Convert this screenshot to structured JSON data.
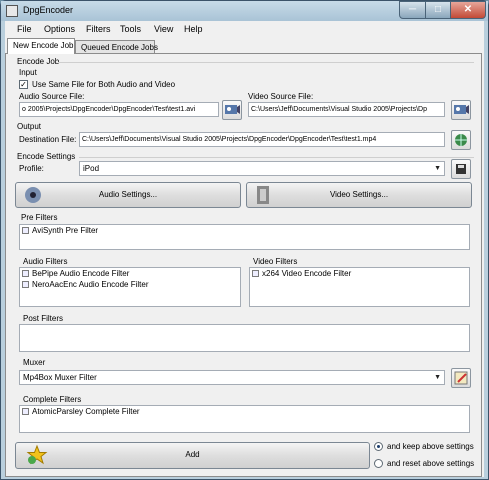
{
  "window": {
    "title": "DpgEncoder",
    "minimize": "─",
    "maximize": "□",
    "close": "✕"
  },
  "menu": [
    "File",
    "Options",
    "Filters",
    "Tools",
    "View",
    "Help"
  ],
  "tabs": [
    "New Encode Job",
    "Queued Encode Jobs"
  ],
  "encode_job": {
    "group_label": "Encode Job",
    "input_label": "Input",
    "same_file_checkbox": {
      "label": "Use Same File for Both Audio and Video",
      "checked": true
    },
    "audio_source_label": "Audio Source File:",
    "audio_source_value": "o 2005\\Projects\\DpgEncoder\\DpgEncoder\\Test\\test1.avi",
    "video_source_label": "Video Source File:",
    "video_source_value": "C:\\Users\\Jeff\\Documents\\Visual Studio 2005\\Projects\\Dp",
    "output_label": "Output",
    "destination_label": "Destination File:",
    "destination_value": "C:\\Users\\Jeff\\Documents\\Visual Studio 2005\\Projects\\DpgEncoder\\DpgEncoder\\Test\\test1.mp4"
  },
  "encode_settings": {
    "group_label": "Encode Settings",
    "profile_label": "Profile:",
    "profile_value": "iPod",
    "audio_settings_button": "Audio Settings...",
    "video_settings_button": "Video Settings..."
  },
  "pre_filters": {
    "label": "Pre Filters",
    "items": [
      "AviSynth Pre Filter"
    ]
  },
  "audio_filters": {
    "label": "Audio Filters",
    "items": [
      "BePipe Audio Encode Filter",
      "NeroAacEnc Audio Encode Filter"
    ]
  },
  "video_filters": {
    "label": "Video Filters",
    "items": [
      "x264 Video Encode Filter"
    ]
  },
  "post_filters": {
    "label": "Post Filters",
    "items": []
  },
  "muxer": {
    "label": "Muxer",
    "value": "Mp4Box Muxer Filter"
  },
  "complete_filters": {
    "label": "Complete Filters",
    "items": [
      "AtomicParsley Complete Filter"
    ]
  },
  "add_button": "Add",
  "add_options": [
    {
      "label": "and keep above settings",
      "checked": true
    },
    {
      "label": "and reset above settings",
      "checked": false
    }
  ],
  "colors": {
    "title_bar": "#b9cfdd",
    "panel": "#f0f0f0"
  }
}
